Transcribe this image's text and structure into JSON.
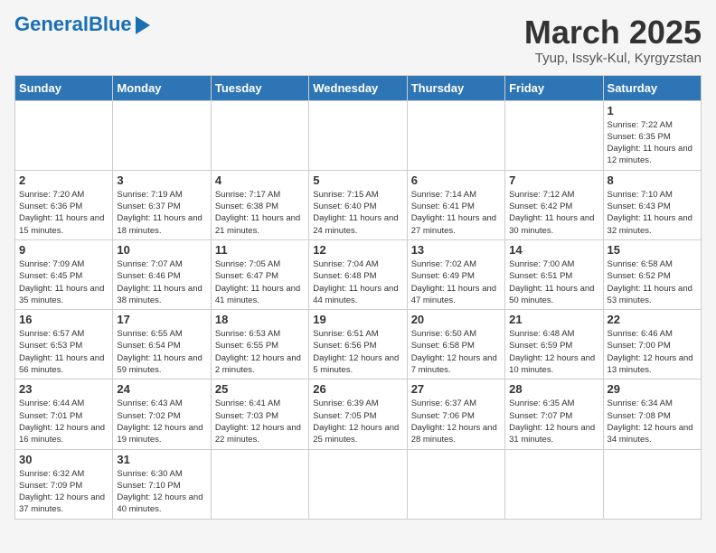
{
  "header": {
    "logo_general": "General",
    "logo_blue": "Blue",
    "month_title": "March 2025",
    "location": "Tyup, Issyk-Kul, Kyrgyzstan"
  },
  "weekdays": [
    "Sunday",
    "Monday",
    "Tuesday",
    "Wednesday",
    "Thursday",
    "Friday",
    "Saturday"
  ],
  "weeks": [
    [
      {
        "day": "",
        "info": ""
      },
      {
        "day": "",
        "info": ""
      },
      {
        "day": "",
        "info": ""
      },
      {
        "day": "",
        "info": ""
      },
      {
        "day": "",
        "info": ""
      },
      {
        "day": "",
        "info": ""
      },
      {
        "day": "1",
        "info": "Sunrise: 7:22 AM\nSunset: 6:35 PM\nDaylight: 11 hours and 12 minutes."
      }
    ],
    [
      {
        "day": "2",
        "info": "Sunrise: 7:20 AM\nSunset: 6:36 PM\nDaylight: 11 hours and 15 minutes."
      },
      {
        "day": "3",
        "info": "Sunrise: 7:19 AM\nSunset: 6:37 PM\nDaylight: 11 hours and 18 minutes."
      },
      {
        "day": "4",
        "info": "Sunrise: 7:17 AM\nSunset: 6:38 PM\nDaylight: 11 hours and 21 minutes."
      },
      {
        "day": "5",
        "info": "Sunrise: 7:15 AM\nSunset: 6:40 PM\nDaylight: 11 hours and 24 minutes."
      },
      {
        "day": "6",
        "info": "Sunrise: 7:14 AM\nSunset: 6:41 PM\nDaylight: 11 hours and 27 minutes."
      },
      {
        "day": "7",
        "info": "Sunrise: 7:12 AM\nSunset: 6:42 PM\nDaylight: 11 hours and 30 minutes."
      },
      {
        "day": "8",
        "info": "Sunrise: 7:10 AM\nSunset: 6:43 PM\nDaylight: 11 hours and 32 minutes."
      }
    ],
    [
      {
        "day": "9",
        "info": "Sunrise: 7:09 AM\nSunset: 6:45 PM\nDaylight: 11 hours and 35 minutes."
      },
      {
        "day": "10",
        "info": "Sunrise: 7:07 AM\nSunset: 6:46 PM\nDaylight: 11 hours and 38 minutes."
      },
      {
        "day": "11",
        "info": "Sunrise: 7:05 AM\nSunset: 6:47 PM\nDaylight: 11 hours and 41 minutes."
      },
      {
        "day": "12",
        "info": "Sunrise: 7:04 AM\nSunset: 6:48 PM\nDaylight: 11 hours and 44 minutes."
      },
      {
        "day": "13",
        "info": "Sunrise: 7:02 AM\nSunset: 6:49 PM\nDaylight: 11 hours and 47 minutes."
      },
      {
        "day": "14",
        "info": "Sunrise: 7:00 AM\nSunset: 6:51 PM\nDaylight: 11 hours and 50 minutes."
      },
      {
        "day": "15",
        "info": "Sunrise: 6:58 AM\nSunset: 6:52 PM\nDaylight: 11 hours and 53 minutes."
      }
    ],
    [
      {
        "day": "16",
        "info": "Sunrise: 6:57 AM\nSunset: 6:53 PM\nDaylight: 11 hours and 56 minutes."
      },
      {
        "day": "17",
        "info": "Sunrise: 6:55 AM\nSunset: 6:54 PM\nDaylight: 11 hours and 59 minutes."
      },
      {
        "day": "18",
        "info": "Sunrise: 6:53 AM\nSunset: 6:55 PM\nDaylight: 12 hours and 2 minutes."
      },
      {
        "day": "19",
        "info": "Sunrise: 6:51 AM\nSunset: 6:56 PM\nDaylight: 12 hours and 5 minutes."
      },
      {
        "day": "20",
        "info": "Sunrise: 6:50 AM\nSunset: 6:58 PM\nDaylight: 12 hours and 7 minutes."
      },
      {
        "day": "21",
        "info": "Sunrise: 6:48 AM\nSunset: 6:59 PM\nDaylight: 12 hours and 10 minutes."
      },
      {
        "day": "22",
        "info": "Sunrise: 6:46 AM\nSunset: 7:00 PM\nDaylight: 12 hours and 13 minutes."
      }
    ],
    [
      {
        "day": "23",
        "info": "Sunrise: 6:44 AM\nSunset: 7:01 PM\nDaylight: 12 hours and 16 minutes."
      },
      {
        "day": "24",
        "info": "Sunrise: 6:43 AM\nSunset: 7:02 PM\nDaylight: 12 hours and 19 minutes."
      },
      {
        "day": "25",
        "info": "Sunrise: 6:41 AM\nSunset: 7:03 PM\nDaylight: 12 hours and 22 minutes."
      },
      {
        "day": "26",
        "info": "Sunrise: 6:39 AM\nSunset: 7:05 PM\nDaylight: 12 hours and 25 minutes."
      },
      {
        "day": "27",
        "info": "Sunrise: 6:37 AM\nSunset: 7:06 PM\nDaylight: 12 hours and 28 minutes."
      },
      {
        "day": "28",
        "info": "Sunrise: 6:35 AM\nSunset: 7:07 PM\nDaylight: 12 hours and 31 minutes."
      },
      {
        "day": "29",
        "info": "Sunrise: 6:34 AM\nSunset: 7:08 PM\nDaylight: 12 hours and 34 minutes."
      }
    ],
    [
      {
        "day": "30",
        "info": "Sunrise: 6:32 AM\nSunset: 7:09 PM\nDaylight: 12 hours and 37 minutes."
      },
      {
        "day": "31",
        "info": "Sunrise: 6:30 AM\nSunset: 7:10 PM\nDaylight: 12 hours and 40 minutes."
      },
      {
        "day": "",
        "info": ""
      },
      {
        "day": "",
        "info": ""
      },
      {
        "day": "",
        "info": ""
      },
      {
        "day": "",
        "info": ""
      },
      {
        "day": "",
        "info": ""
      }
    ]
  ]
}
